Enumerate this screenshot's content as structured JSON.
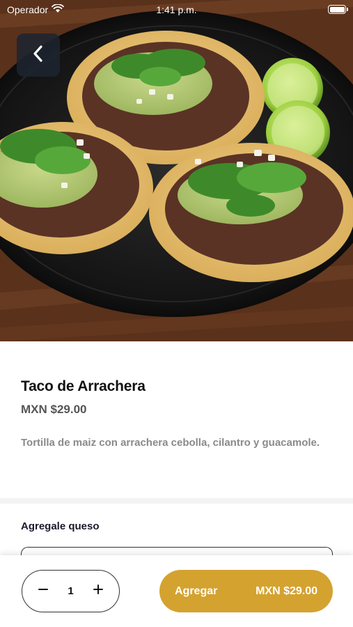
{
  "status_bar": {
    "carrier": "Operador",
    "time": "1:41 p.m."
  },
  "product": {
    "name": "Taco de Arrachera",
    "price": "MXN $29.00",
    "description": "Tortilla de maiz con arrachera cebolla, cilantro y guacamole."
  },
  "options": {
    "title": "Agregale queso"
  },
  "bottom_bar": {
    "quantity": "1",
    "add_label": "Agregar",
    "add_price": "MXN $29.00"
  },
  "colors": {
    "accent": "#d4a22f",
    "back_button": "#1e2430",
    "description_text": "#8a8a8a"
  },
  "icons": {
    "back": "chevron-left-icon",
    "wifi": "wifi-icon",
    "battery": "battery-icon",
    "minus": "minus-icon",
    "plus": "plus-icon"
  }
}
